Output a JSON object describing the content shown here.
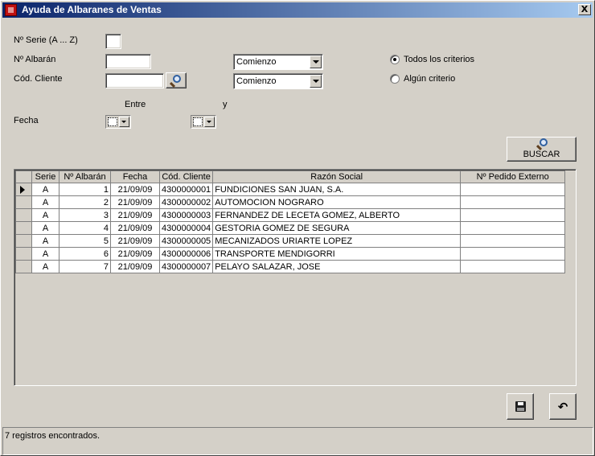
{
  "window": {
    "title": "Ayuda de Albaranes de Ventas",
    "close_glyph": "X"
  },
  "form": {
    "serie_label": "Nº Serie (A ... Z)",
    "serie_value": "",
    "albaran_label": "Nº Albarán",
    "albaran_value": "",
    "albaran_match": "Comienzo",
    "cliente_label": "Cód. Cliente",
    "cliente_value": "",
    "cliente_match": "Comienzo",
    "criteria_all_label": "Todos los criterios",
    "criteria_any_label": "Algún criterio",
    "criteria_selected": "all",
    "entre_label": "Entre",
    "y_label": "y",
    "fecha_label": "Fecha"
  },
  "buttons": {
    "buscar_label": "BUSCAR",
    "save_icon": "floppy-disk-icon",
    "undo_icon": "undo-arrow-icon",
    "undo_glyph": "↶"
  },
  "table": {
    "columns": [
      "Serie",
      "Nº Albarán",
      "Fecha",
      "Cód. Cliente",
      "Razón Social",
      "Nº Pedido Externo"
    ],
    "rows": [
      {
        "serie": "A",
        "albaran": "1",
        "fecha": "21/09/09",
        "cliente": "4300000001",
        "razon": "FUNDICIONES SAN JUAN, S.A.",
        "pedido": ""
      },
      {
        "serie": "A",
        "albaran": "2",
        "fecha": "21/09/09",
        "cliente": "4300000002",
        "razon": "AUTOMOCION NOGRARO",
        "pedido": ""
      },
      {
        "serie": "A",
        "albaran": "3",
        "fecha": "21/09/09",
        "cliente": "4300000003",
        "razon": "FERNANDEZ DE LECETA GOMEZ, ALBERTO",
        "pedido": ""
      },
      {
        "serie": "A",
        "albaran": "4",
        "fecha": "21/09/09",
        "cliente": "4300000004",
        "razon": "GESTORIA GOMEZ DE SEGURA",
        "pedido": ""
      },
      {
        "serie": "A",
        "albaran": "5",
        "fecha": "21/09/09",
        "cliente": "4300000005",
        "razon": "MECANIZADOS URIARTE LOPEZ",
        "pedido": ""
      },
      {
        "serie": "A",
        "albaran": "6",
        "fecha": "21/09/09",
        "cliente": "4300000006",
        "razon": "TRANSPORTE MENDIGORRI",
        "pedido": ""
      },
      {
        "serie": "A",
        "albaran": "7",
        "fecha": "21/09/09",
        "cliente": "4300000007",
        "razon": "PELAYO SALAZAR, JOSE",
        "pedido": ""
      }
    ]
  },
  "status": {
    "text": "7 registros encontrados."
  },
  "colors": {
    "title_start": "#0a246a",
    "title_end": "#a6caf0",
    "face": "#d4d0c8"
  }
}
